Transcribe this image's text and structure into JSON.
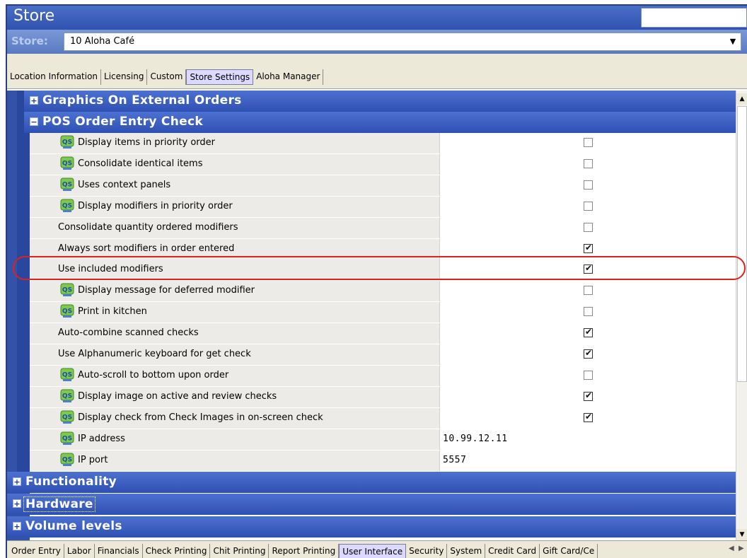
{
  "window": {
    "title": "Store"
  },
  "store": {
    "label": "Store:",
    "value": "10 Aloha Café"
  },
  "top_tabs": [
    {
      "label": "Location Information",
      "active": false
    },
    {
      "label": "Licensing",
      "active": false
    },
    {
      "label": "Custom",
      "active": false
    },
    {
      "label": "Store Settings",
      "active": true
    },
    {
      "label": "Aloha Manager",
      "active": false
    }
  ],
  "groups": {
    "graphics": {
      "label": "Graphics On External Orders",
      "expanded": false
    },
    "pos_order_entry": {
      "label": "POS Order Entry Check",
      "expanded": true
    },
    "functionality": {
      "label": "Functionality",
      "expanded": false
    },
    "hardware": {
      "label": "Hardware",
      "expanded": false
    },
    "volume": {
      "label": "Volume levels",
      "expanded": false
    }
  },
  "properties": [
    {
      "label": "Display items in priority order",
      "qs": true,
      "type": "checkbox",
      "checked": false
    },
    {
      "label": "Consolidate identical items",
      "qs": true,
      "type": "checkbox",
      "checked": false
    },
    {
      "label": "Uses context panels",
      "qs": true,
      "type": "checkbox",
      "checked": false
    },
    {
      "label": "Display modifiers in priority order",
      "qs": true,
      "type": "checkbox",
      "checked": false
    },
    {
      "label": "Consolidate quantity ordered modifiers",
      "qs": false,
      "type": "checkbox",
      "checked": false
    },
    {
      "label": "Always sort modifiers in order entered",
      "qs": false,
      "type": "checkbox",
      "checked": true
    },
    {
      "label": "Use included modifiers",
      "qs": false,
      "type": "checkbox",
      "checked": true
    },
    {
      "label": "Display message for deferred modifier",
      "qs": true,
      "type": "checkbox",
      "checked": false
    },
    {
      "label": "Print in kitchen",
      "qs": true,
      "type": "checkbox",
      "checked": false
    },
    {
      "label": "Auto-combine scanned checks",
      "qs": false,
      "type": "checkbox",
      "checked": true
    },
    {
      "label": "Use Alphanumeric keyboard for get check",
      "qs": false,
      "type": "checkbox",
      "checked": true
    },
    {
      "label": "Auto-scroll to bottom upon order",
      "qs": true,
      "type": "checkbox",
      "checked": false
    },
    {
      "label": "Display image on active and review checks",
      "qs": true,
      "type": "checkbox",
      "checked": true
    },
    {
      "label": "Display check from Check Images in on-screen check",
      "qs": true,
      "type": "checkbox",
      "checked": true
    },
    {
      "label": "IP address",
      "qs": true,
      "type": "text",
      "value": "10.99.12.11"
    },
    {
      "label": "IP port",
      "qs": true,
      "type": "text",
      "value": "5557"
    }
  ],
  "bottom_tabs": [
    {
      "label": "Order Entry",
      "active": false
    },
    {
      "label": "Labor",
      "active": false
    },
    {
      "label": "Financials",
      "active": false
    },
    {
      "label": "Check Printing",
      "active": false
    },
    {
      "label": "Chit Printing",
      "active": false
    },
    {
      "label": "Report Printing",
      "active": false
    },
    {
      "label": "User Interface",
      "active": true
    },
    {
      "label": "Security",
      "active": false
    },
    {
      "label": "System",
      "active": false
    },
    {
      "label": "Credit Card",
      "active": false
    },
    {
      "label": "Gift Card/Ce",
      "active": false
    }
  ],
  "icons": {
    "qs": "quick-service-icon",
    "expand": "plus-box-icon",
    "collapse": "minus-box-icon",
    "dropdown": "chevron-down-icon"
  },
  "colors": {
    "group_header": "#2e50b4",
    "highlight": "#e0201e",
    "title_bar": "#3a5fbf"
  }
}
